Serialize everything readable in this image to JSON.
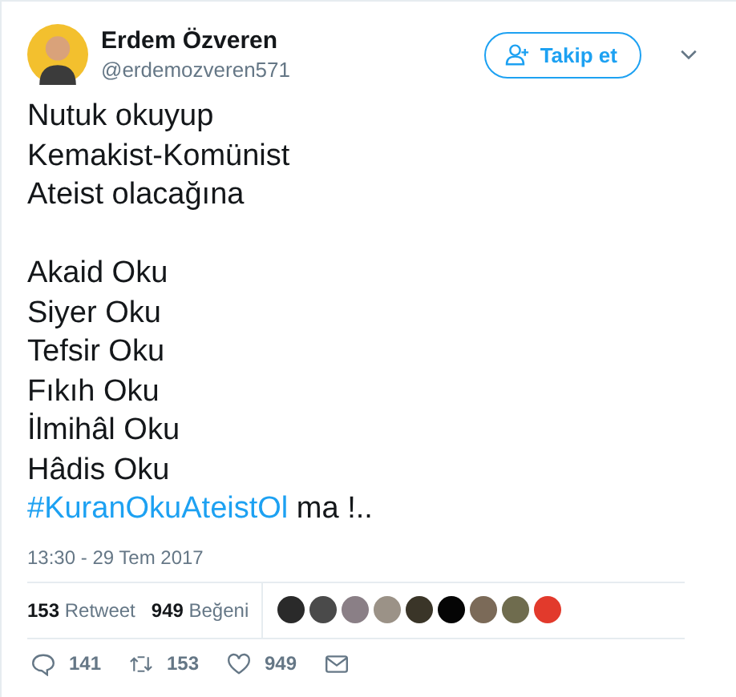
{
  "author": {
    "name": "Erdem Özveren",
    "handle": "@erdemozveren571"
  },
  "follow_button": {
    "label": "Takip et"
  },
  "paragraphs": [
    [
      "Nutuk okuyup",
      "Kemakist-Komünist",
      "Ateist olacağına"
    ],
    [
      "Akaid Oku",
      "Siyer Oku",
      "Tefsir Oku",
      "Fıkıh Oku",
      "İlmihâl Oku",
      "Hâdis Oku"
    ]
  ],
  "hashtag_line": {
    "hashtag": "#KuranOkuAteistOl",
    "rest": "ma !.."
  },
  "timestamp": "13:30 - 29 Tem 2017",
  "stats": [
    {
      "count": "153",
      "label": "Retweet"
    },
    {
      "count": "949",
      "label": "Beğeni"
    }
  ],
  "likers": [
    {
      "color": "#2a2a2a"
    },
    {
      "color": "#4a4a4a"
    },
    {
      "color": "#8a7f86"
    },
    {
      "color": "#9b9287"
    },
    {
      "color": "#3a3528"
    },
    {
      "color": "#050505"
    },
    {
      "color": "#7b6a58"
    },
    {
      "color": "#6f6c4e"
    },
    {
      "color": "#e23a2c"
    }
  ],
  "actions": [
    {
      "kind": "reply",
      "count": "141"
    },
    {
      "kind": "retweet",
      "count": "153"
    },
    {
      "kind": "like",
      "count": "949"
    },
    {
      "kind": "message"
    }
  ]
}
